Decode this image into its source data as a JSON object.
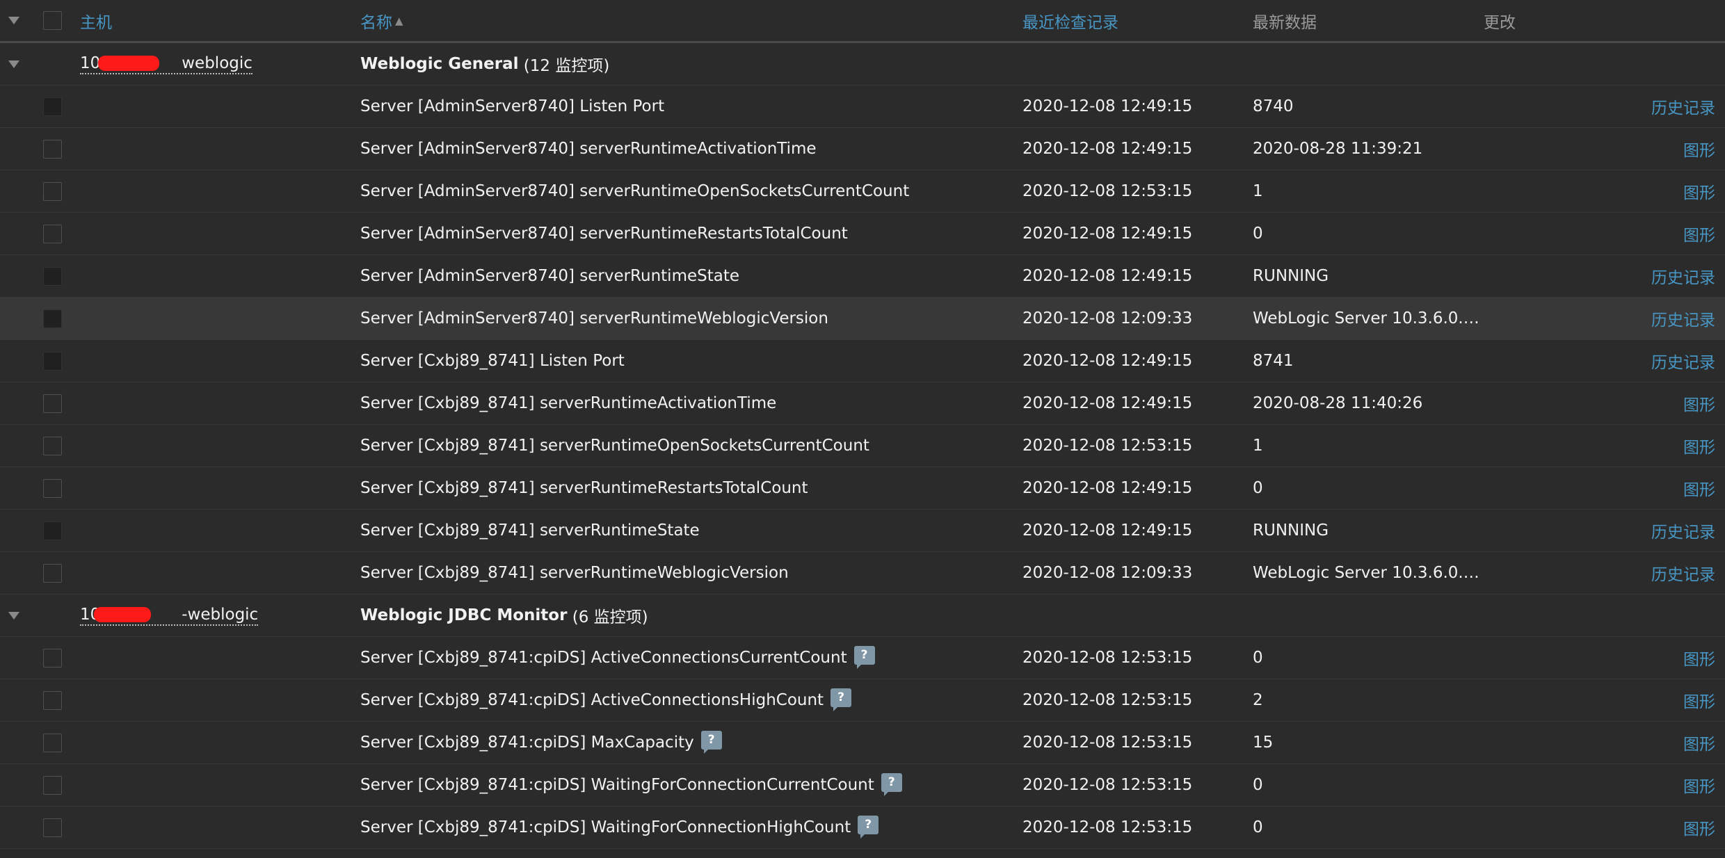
{
  "header": {
    "host": "主机",
    "name": "名称",
    "name_sort": "▲",
    "last_check": "最近检查记录",
    "latest_data": "最新数据",
    "change": "更改"
  },
  "groups": [
    {
      "host": "10.               weblogic",
      "title": "Weblogic General",
      "count": "(12 监控项)",
      "items": [
        {
          "name": "Server [AdminServer8740] Listen Port",
          "last": "2020-12-08 12:49:15",
          "value": "8740",
          "action": "历史记录"
        },
        {
          "name": "Server [AdminServer8740] serverRuntimeActivationTime",
          "last": "2020-12-08 12:49:15",
          "value": "2020-08-28 11:39:21",
          "action": "图形"
        },
        {
          "name": "Server [AdminServer8740] serverRuntimeOpenSocketsCurrentCount",
          "last": "2020-12-08 12:53:15",
          "value": "1",
          "action": "图形"
        },
        {
          "name": "Server [AdminServer8740] serverRuntimeRestartsTotalCount",
          "last": "2020-12-08 12:49:15",
          "value": "0",
          "action": "图形"
        },
        {
          "name": "Server [AdminServer8740] serverRuntimeState",
          "last": "2020-12-08 12:49:15",
          "value": "RUNNING",
          "action": "历史记录"
        },
        {
          "name": "Server [AdminServer8740] serverRuntimeWeblogicVersion",
          "last": "2020-12-08 12:09:33",
          "value": "WebLogic Server 10.3.6.0.…",
          "action": "历史记录"
        },
        {
          "name": "Server [Cxbj89_8741] Listen Port",
          "last": "2020-12-08 12:49:15",
          "value": "8741",
          "action": "历史记录"
        },
        {
          "name": "Server [Cxbj89_8741] serverRuntimeActivationTime",
          "last": "2020-12-08 12:49:15",
          "value": "2020-08-28 11:40:26",
          "action": "图形"
        },
        {
          "name": "Server [Cxbj89_8741] serverRuntimeOpenSocketsCurrentCount",
          "last": "2020-12-08 12:53:15",
          "value": "1",
          "action": "图形"
        },
        {
          "name": "Server [Cxbj89_8741] serverRuntimeRestartsTotalCount",
          "last": "2020-12-08 12:49:15",
          "value": "0",
          "action": "图形"
        },
        {
          "name": "Server [Cxbj89_8741] serverRuntimeState",
          "last": "2020-12-08 12:49:15",
          "value": "RUNNING",
          "action": "历史记录"
        },
        {
          "name": "Server [Cxbj89_8741] serverRuntimeWeblogicVersion",
          "last": "2020-12-08 12:09:33",
          "value": "WebLogic Server 10.3.6.0.…",
          "action": "历史记录"
        }
      ]
    },
    {
      "host": "10                -weblogic",
      "title": "Weblogic JDBC Monitor",
      "count": "(6 监控项)",
      "items": [
        {
          "name": "Server [Cxbj89_8741:cpiDS] ActiveConnectionsCurrentCount",
          "last": "2020-12-08 12:53:15",
          "value": "0",
          "action": "图形",
          "help": "?"
        },
        {
          "name": "Server [Cxbj89_8741:cpiDS] ActiveConnectionsHighCount",
          "last": "2020-12-08 12:53:15",
          "value": "2",
          "action": "图形",
          "help": "?"
        },
        {
          "name": "Server [Cxbj89_8741:cpiDS] MaxCapacity",
          "last": "2020-12-08 12:53:15",
          "value": "15",
          "action": "图形",
          "help": "?"
        },
        {
          "name": "Server [Cxbj89_8741:cpiDS] WaitingForConnectionCurrentCount",
          "last": "2020-12-08 12:53:15",
          "value": "0",
          "action": "图形",
          "help": "?"
        },
        {
          "name": "Server [Cxbj89_8741:cpiDS] WaitingForConnectionHighCount",
          "last": "2020-12-08 12:53:15",
          "value": "0",
          "action": "图形",
          "help": "?"
        }
      ]
    }
  ]
}
